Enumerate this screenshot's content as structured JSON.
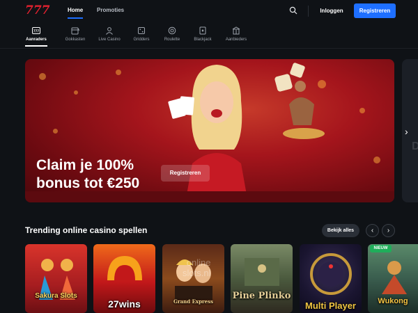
{
  "header": {
    "logo_text": "777",
    "nav": [
      {
        "label": "Home",
        "active": true
      },
      {
        "label": "Promoties",
        "active": false
      }
    ],
    "search_icon": "search-icon",
    "login_label": "Inloggen",
    "register_label": "Registreren",
    "accent_color": "#1e6fff",
    "brand_color": "#e3212f"
  },
  "categories": [
    {
      "label": "Aanraders",
      "icon": "777-tile-icon",
      "active": true
    },
    {
      "label": "Gokkasten",
      "icon": "slot-machine-icon",
      "active": false
    },
    {
      "label": "Live Casino",
      "icon": "dealer-icon",
      "active": false
    },
    {
      "label": "Gridders",
      "icon": "dice-icon",
      "active": false
    },
    {
      "label": "Roulette",
      "icon": "roulette-icon",
      "active": false
    },
    {
      "label": "Blackjack",
      "icon": "card-icon",
      "active": false
    },
    {
      "label": "Aanbieders",
      "icon": "building-icon",
      "active": false
    }
  ],
  "banner": {
    "headline_line1": "Claim je 100%",
    "headline_line2": "bonus tot €250",
    "button_label": "Registreren",
    "next_arrow": "chevron-right-icon",
    "peek_text": "D"
  },
  "trending": {
    "title": "Trending online casino spellen",
    "view_all_label": "Bekijk alles",
    "prev_icon": "chevron-left-icon",
    "next_icon": "chevron-right-icon",
    "games": [
      {
        "name": "Sakura Slots"
      },
      {
        "name": "27wins"
      },
      {
        "name": "Grand Express"
      },
      {
        "name": "Pine Plinko"
      },
      {
        "name": "Multi Player"
      },
      {
        "name": "Wukong",
        "badge": "NIEUW"
      }
    ],
    "watermark_line1": "online",
    "watermark_line2": "slots.nl"
  }
}
